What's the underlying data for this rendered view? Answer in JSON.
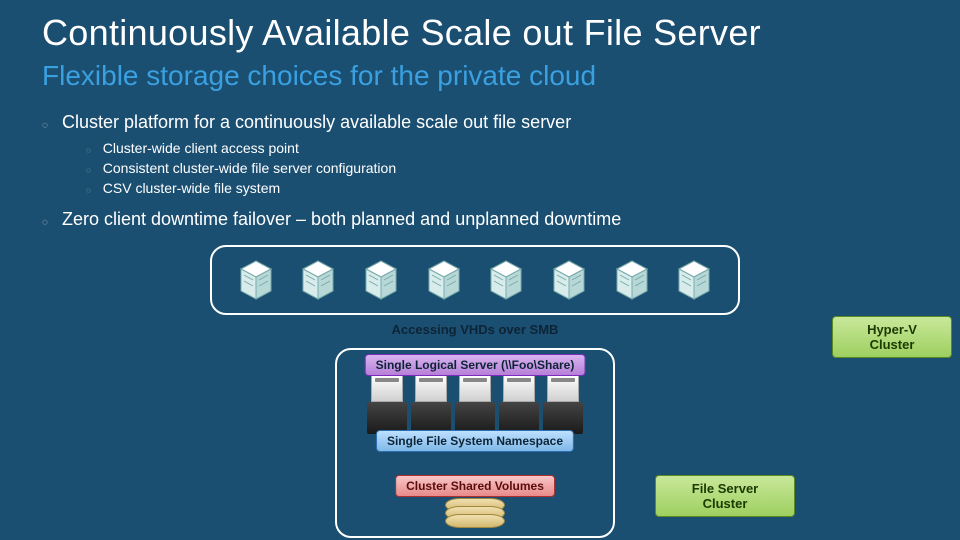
{
  "title": "Continuously Available Scale out File Server",
  "subtitle": "Flexible storage choices for the private cloud",
  "bullets": [
    {
      "text": "Cluster platform for a continuously available scale out file server",
      "sub": [
        "Cluster-wide client access point",
        "Consistent cluster-wide file server configuration",
        "CSV cluster-wide file system"
      ]
    },
    {
      "text": "Zero client downtime failover – both planned and unplanned downtime",
      "sub": []
    }
  ],
  "diagram": {
    "accessing_label": "Accessing VHDs over SMB",
    "logical_server_label": "Single Logical Server  (\\\\Foo\\Share)",
    "namespace_label": "Single File System Namespace",
    "csv_label": "Cluster Shared Volumes",
    "hyperv_label": "Hyper-V Cluster",
    "fileserver_label": "File Server Cluster",
    "hyperv_node_count": 8,
    "fileserver_node_count": 5
  }
}
